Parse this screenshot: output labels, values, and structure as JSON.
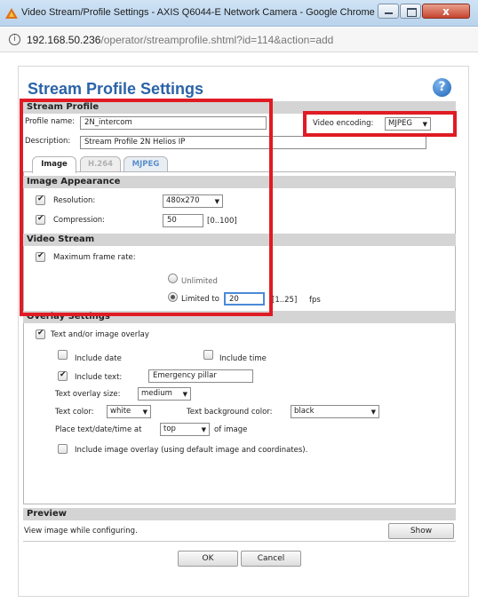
{
  "window": {
    "title": "Video Stream/Profile Settings - AXIS Q6044-E Network Camera - Google Chrome",
    "close_glyph": "x"
  },
  "address": {
    "host": "192.168.50.236",
    "path": "/operator/streamprofile.shtml?id=114&action=add"
  },
  "page": {
    "title": "Stream Profile Settings",
    "help_glyph": "?"
  },
  "stream_profile": {
    "heading": "Stream Profile",
    "profile_name_label": "Profile name:",
    "profile_name_value": "2N_intercom",
    "description_label": "Description:",
    "description_value": "Stream Profile 2N Helios IP",
    "video_encoding_label": "Video encoding:",
    "video_encoding_value": "MJPEG"
  },
  "tabs": [
    {
      "label": "Image",
      "state": "active"
    },
    {
      "label": "H.264",
      "state": "disabled"
    },
    {
      "label": "MJPEG",
      "state": "inactive"
    }
  ],
  "image_appearance": {
    "heading": "Image Appearance",
    "resolution_label": "Resolution:",
    "resolution_value": "480x270",
    "compression_label": "Compression:",
    "compression_value": "50",
    "compression_range": "[0..100]"
  },
  "video_stream": {
    "heading": "Video Stream",
    "max_frame_rate_label": "Maximum frame rate:",
    "unlimited_label": "Unlimited",
    "limited_label": "Limited to",
    "limited_value": "20",
    "limited_range": "[1..25]",
    "unit": "fps"
  },
  "overlay": {
    "heading": "Overlay Settings",
    "text_image_overlay_label": "Text and/or image overlay",
    "include_date_label": "Include date",
    "include_time_label": "Include time",
    "include_text_label": "Include text:",
    "include_text_value": "Emergency pillar",
    "text_size_label": "Text overlay size:",
    "text_size_value": "medium",
    "text_color_label": "Text color:",
    "text_color_value": "white",
    "text_bg_color_label": "Text background color:",
    "text_bg_color_value": "black",
    "place_label": "Place text/date/time at",
    "place_value": "top",
    "place_suffix": "of image",
    "include_image_overlay_label": "Include image overlay (using default image and coordinates)."
  },
  "preview": {
    "heading": "Preview",
    "description": "View image while configuring.",
    "show_button": "Show"
  },
  "footer": {
    "ok_button": "OK",
    "cancel_button": "Cancel"
  },
  "colors": {
    "title_blue": "#2a63a8",
    "highlight_red": "#e01b24",
    "section_gray": "#d4d4d4"
  },
  "icons": {
    "app": "axis-triangle-icon",
    "info": "info-icon",
    "help": "help-icon",
    "dropdown": "dropdown-arrow-icon"
  }
}
